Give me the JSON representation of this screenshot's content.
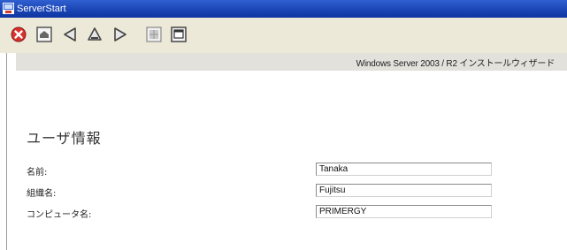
{
  "window": {
    "title": "ServerStart"
  },
  "toolbar": {
    "buttons": [
      {
        "icon": "close-icon"
      },
      {
        "icon": "home-icon"
      },
      {
        "icon": "back-icon"
      },
      {
        "icon": "up-icon"
      },
      {
        "icon": "forward-icon"
      },
      {
        "icon": "grid-icon"
      },
      {
        "icon": "window-icon"
      }
    ]
  },
  "banner": {
    "text": "Windows Server 2003 / R2 インストールウィザード"
  },
  "main": {
    "heading": "ユーザ情報",
    "fields": [
      {
        "label": "名前:",
        "value": "Tanaka"
      },
      {
        "label": "組織名:",
        "value": "Fujitsu"
      },
      {
        "label": "コンピュータ名:",
        "value": "PRIMERGY"
      }
    ]
  },
  "colors": {
    "titlebar": "#1a44b3",
    "toolbar": "#ece9d8",
    "banner": "#e3e1dc",
    "close_red": "#d8302c"
  }
}
